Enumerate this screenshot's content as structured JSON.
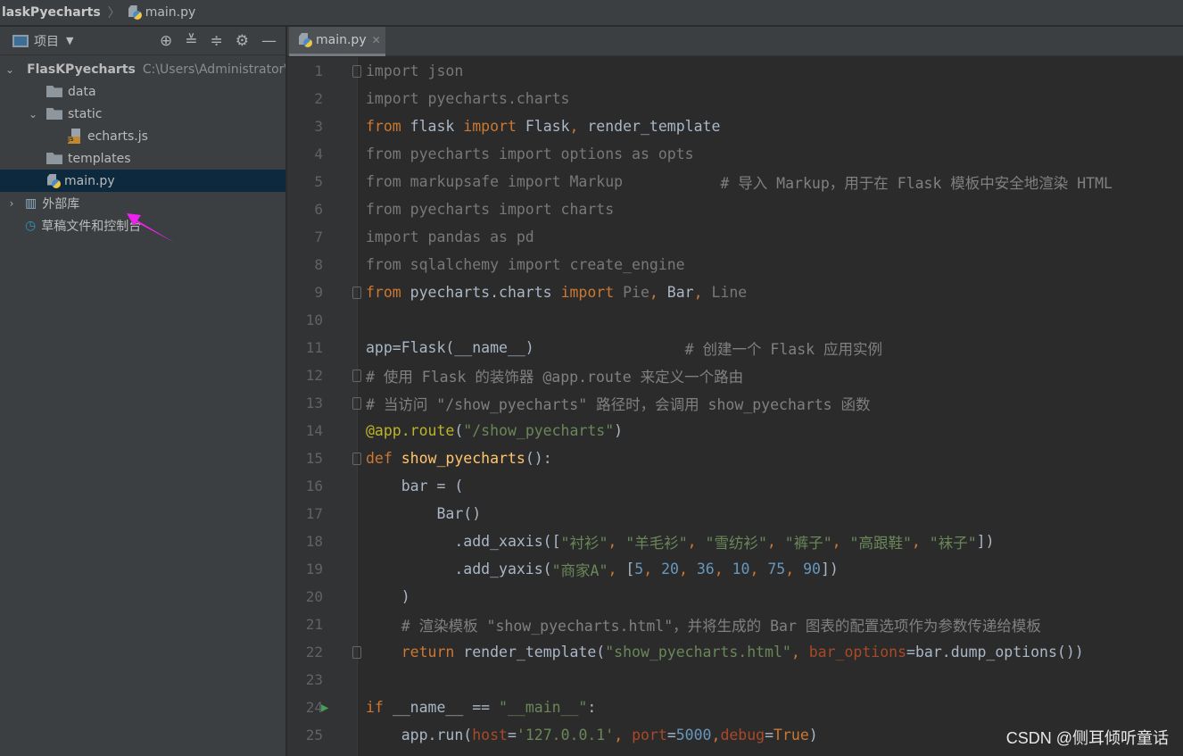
{
  "breadcrumb": {
    "project": "laskPyecharts",
    "file": "main.py"
  },
  "sidebar": {
    "title": "项目",
    "tools": [
      "locate-icon",
      "expand-all-icon",
      "collapse-all-icon",
      "gear-icon",
      "minimize-icon"
    ],
    "tree": [
      {
        "label": "FlasKPyecharts",
        "path": "C:\\Users\\Administrator\\",
        "indent": 0,
        "chev": "⌄",
        "icon": "folder"
      },
      {
        "label": "data",
        "indent": 1,
        "chev": "",
        "icon": "folder"
      },
      {
        "label": "static",
        "indent": 1,
        "chev": "⌄",
        "icon": "folder"
      },
      {
        "label": "echarts.js",
        "indent": 2,
        "chev": "",
        "icon": "js"
      },
      {
        "label": "templates",
        "indent": 1,
        "chev": "",
        "icon": "folder"
      },
      {
        "label": "main.py",
        "indent": 1,
        "chev": "",
        "icon": "py",
        "selected": true
      },
      {
        "label": "外部库",
        "indent": 0,
        "chev": "›",
        "icon": "library"
      },
      {
        "label": "草稿文件和控制台",
        "indent": 0,
        "chev": "",
        "icon": "scratch"
      }
    ]
  },
  "editor": {
    "tab": "main.py",
    "lines": [
      [
        [
          "import json",
          "g"
        ]
      ],
      [
        [
          "import pyecharts.charts",
          "g"
        ]
      ],
      [
        [
          "from ",
          "k"
        ],
        [
          "flask ",
          "d"
        ],
        [
          "import ",
          "k"
        ],
        [
          "Flask",
          "d"
        ],
        [
          ", ",
          "k"
        ],
        [
          "render_template",
          "d"
        ]
      ],
      [
        [
          "from pyecharts import options as opts",
          "g"
        ]
      ],
      [
        [
          "from markupsafe import Markup",
          "g"
        ],
        [
          "           # 导入 Markup，用于在 Flask 模板中安全地渲染 HTML",
          "c"
        ]
      ],
      [
        [
          "from pyecharts import charts",
          "g"
        ]
      ],
      [
        [
          "import pandas as pd",
          "g"
        ]
      ],
      [
        [
          "from sqlalchemy import create_engine",
          "g"
        ]
      ],
      [
        [
          "from ",
          "k"
        ],
        [
          "pyecharts.charts ",
          "d"
        ],
        [
          "import ",
          "k"
        ],
        [
          "Pie",
          "g"
        ],
        [
          ", ",
          "k"
        ],
        [
          "Bar",
          "d"
        ],
        [
          ", ",
          "k"
        ],
        [
          "Line",
          "g"
        ]
      ],
      [],
      [
        [
          "app=Flask(__name__)",
          "d"
        ],
        [
          "                 # 创建一个 Flask 应用实例",
          "c"
        ]
      ],
      [
        [
          "# 使用 Flask 的装饰器 @app.route 来定义一个路由",
          "c"
        ]
      ],
      [
        [
          "# 当访问 \"/show_pyecharts\" 路径时，会调用 show_pyecharts 函数",
          "c"
        ]
      ],
      [
        [
          "@app.route",
          "dec"
        ],
        [
          "(",
          "d"
        ],
        [
          "\"/show_pyecharts\"",
          "s"
        ],
        [
          ")",
          "d"
        ]
      ],
      [
        [
          "def ",
          "k"
        ],
        [
          "show_pyecharts",
          "f"
        ],
        [
          "():",
          "d"
        ]
      ],
      [
        [
          "    bar = (",
          "d"
        ]
      ],
      [
        [
          "        Bar()",
          "d"
        ]
      ],
      [
        [
          "          .add_xaxis([",
          "d"
        ],
        [
          "\"衬衫\"",
          "s"
        ],
        [
          ", ",
          "k"
        ],
        [
          "\"羊毛衫\"",
          "s"
        ],
        [
          ", ",
          "k"
        ],
        [
          "\"雪纺衫\"",
          "s"
        ],
        [
          ", ",
          "k"
        ],
        [
          "\"裤子\"",
          "s"
        ],
        [
          ", ",
          "k"
        ],
        [
          "\"高跟鞋\"",
          "s"
        ],
        [
          ", ",
          "k"
        ],
        [
          "\"袜子\"",
          "s"
        ],
        [
          "])",
          "d"
        ]
      ],
      [
        [
          "          .add_yaxis(",
          "d"
        ],
        [
          "\"商家A\"",
          "s"
        ],
        [
          ", ",
          "k"
        ],
        [
          "[",
          "d"
        ],
        [
          "5",
          "n"
        ],
        [
          ", ",
          "k"
        ],
        [
          "20",
          "n"
        ],
        [
          ", ",
          "k"
        ],
        [
          "36",
          "n"
        ],
        [
          ", ",
          "k"
        ],
        [
          "10",
          "n"
        ],
        [
          ", ",
          "k"
        ],
        [
          "75",
          "n"
        ],
        [
          ", ",
          "k"
        ],
        [
          "90",
          "n"
        ],
        [
          "])",
          "d"
        ]
      ],
      [
        [
          "    )",
          "d"
        ]
      ],
      [
        [
          "    # 渲染模板 \"show_pyecharts.html\"，并将生成的 Bar 图表的配置选项作为参数传递给模板",
          "c"
        ]
      ],
      [
        [
          "    ",
          "d"
        ],
        [
          "return ",
          "k"
        ],
        [
          "render_template(",
          "d"
        ],
        [
          "\"show_pyecharts.html\"",
          "s"
        ],
        [
          ", ",
          "k"
        ],
        [
          "bar_options",
          "kw"
        ],
        [
          "=bar.dump_options())",
          "d"
        ]
      ],
      [],
      [
        [
          "if ",
          "k"
        ],
        [
          "__name__ == ",
          "d"
        ],
        [
          "\"__main__\"",
          "s"
        ],
        [
          ":",
          "d"
        ]
      ],
      [
        [
          "    app.run(",
          "d"
        ],
        [
          "host",
          "kw"
        ],
        [
          "=",
          "d"
        ],
        [
          "'127.0.0.1'",
          "s"
        ],
        [
          ", ",
          "k"
        ],
        [
          "port",
          "kw"
        ],
        [
          "=",
          "d"
        ],
        [
          "5000",
          "n"
        ],
        [
          ",",
          "k"
        ],
        [
          "debug",
          "kw"
        ],
        [
          "=",
          "d"
        ],
        [
          "True",
          "k"
        ],
        [
          ")",
          "d"
        ]
      ]
    ],
    "fold_lines": [
      1,
      9,
      12,
      13,
      15,
      22
    ],
    "run_line": 24
  },
  "watermark": "CSDN @侧耳倾听童话"
}
